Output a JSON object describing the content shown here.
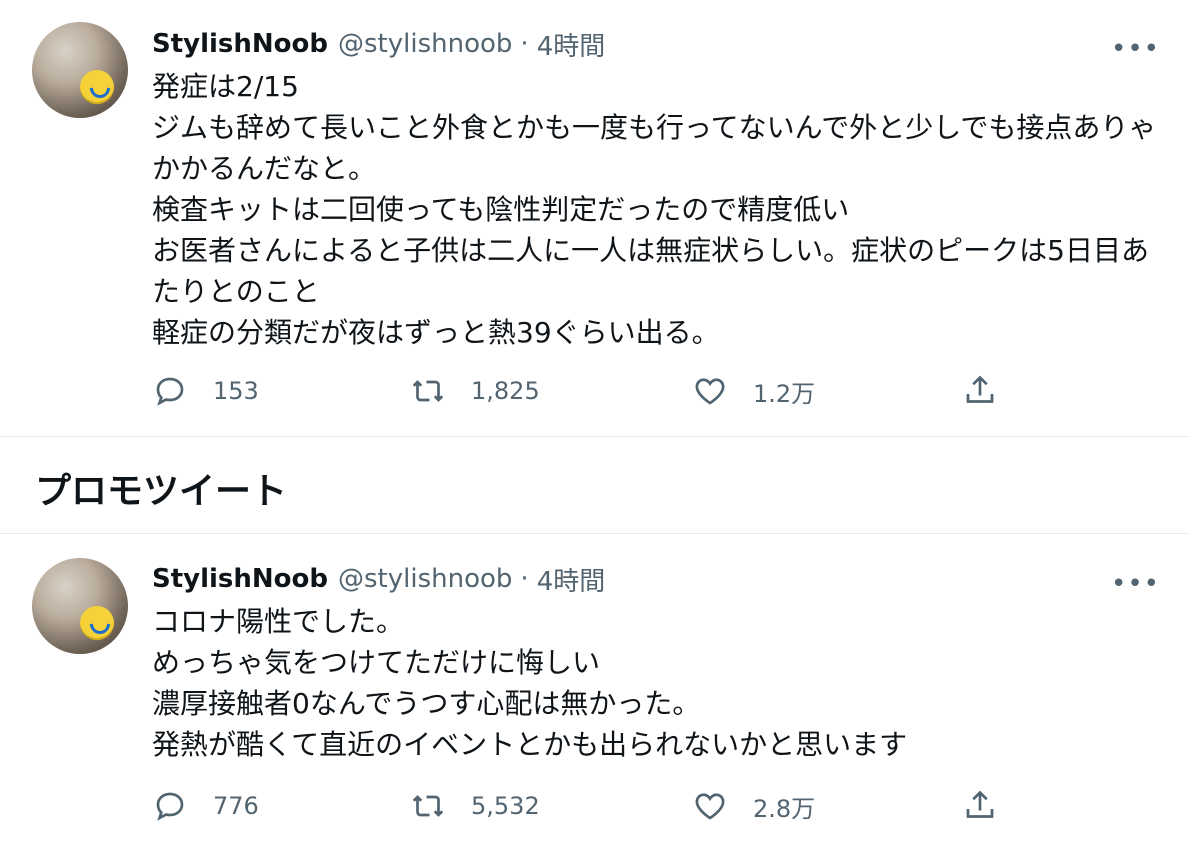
{
  "tweets": [
    {
      "author_name": "StylishNoob",
      "handle": "@stylishnoob",
      "separator": "·",
      "time": "4時間",
      "text": "発症は2/15\nジムも辞めて長いこと外食とかも一度も行ってないんで外と少しでも接点ありゃかかるんだなと。\n検査キットは二回使っても陰性判定だったので精度低い\nお医者さんによると子供は二人に一人は無症状らしい。症状のピークは5日目あたりとのこと\n軽症の分類だが夜はずっと熱39ぐらい出る。",
      "replies": "153",
      "retweets": "1,825",
      "likes": "1.2万"
    },
    {
      "author_name": "StylishNoob",
      "handle": "@stylishnoob",
      "separator": "·",
      "time": "4時間",
      "text": "コロナ陽性でした。\nめっちゃ気をつけてただけに悔しい\n濃厚接触者0なんでうつす心配は無かった。\n発熱が酷くて直近のイベントとかも出られないかと思います",
      "replies": "776",
      "retweets": "5,532",
      "likes": "2.8万"
    }
  ],
  "promo_label": "プロモツイート",
  "more_label": "•••",
  "icons": {
    "reply": "reply-icon",
    "retweet": "retweet-icon",
    "like": "heart-icon",
    "share": "share-icon",
    "more": "more-icon"
  },
  "colors": {
    "text": "#0f1419",
    "secondary": "#536471",
    "divider": "#e6ecf0"
  }
}
